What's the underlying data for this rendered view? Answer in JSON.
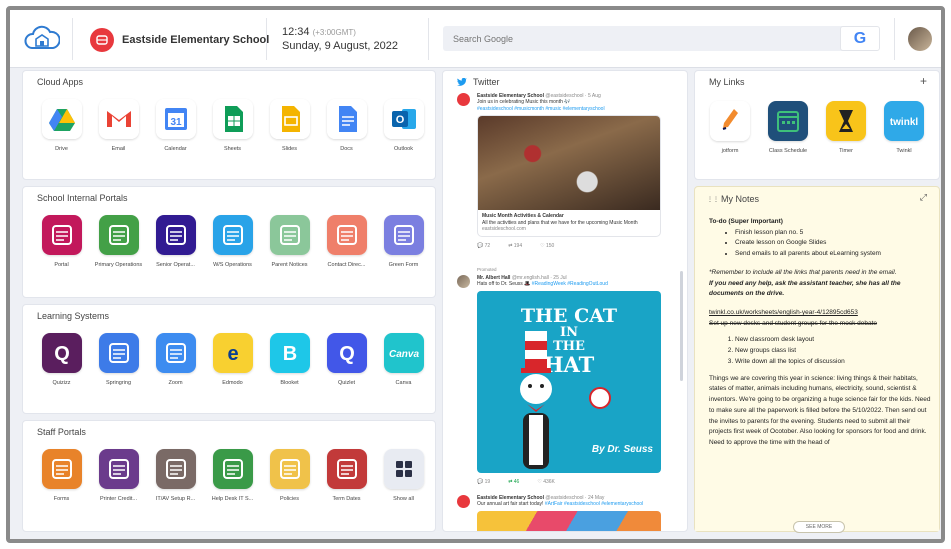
{
  "header": {
    "school_name": "Eastside Elementary School",
    "time": "12:34",
    "timezone": "(+3:00GMT)",
    "date": "Sunday, 9 August, 2022",
    "search_placeholder": "Search Google",
    "google_letter": "G"
  },
  "cloud_apps": {
    "title": "Cloud Apps",
    "items": [
      {
        "label": "Drive",
        "icon": "google-drive-icon"
      },
      {
        "label": "Email",
        "icon": "gmail-icon"
      },
      {
        "label": "Calendar",
        "icon": "calendar-icon",
        "glyph": "31"
      },
      {
        "label": "Sheets",
        "icon": "sheets-icon"
      },
      {
        "label": "Slides",
        "icon": "slides-icon"
      },
      {
        "label": "Docs",
        "icon": "docs-icon"
      },
      {
        "label": "Outlook",
        "icon": "outlook-icon",
        "glyph": "O"
      }
    ]
  },
  "internal_portals": {
    "title": "School Internal Portals",
    "items": [
      {
        "label": "Portal",
        "icon": "graduation-cap-icon",
        "color": "#c2185b"
      },
      {
        "label": "Primary Operations",
        "icon": "lightbulb-icon",
        "color": "#43a047"
      },
      {
        "label": "Senior Operat...",
        "icon": "book-icon",
        "color": "#311b92"
      },
      {
        "label": "W/S Operations",
        "icon": "apple-icon",
        "color": "#29a3e8"
      },
      {
        "label": "Parent Notices",
        "icon": "notice-board-icon",
        "color": "#8bc79a"
      },
      {
        "label": "Contact Direc...",
        "icon": "contact-icon",
        "color": "#ef7f6a"
      },
      {
        "label": "Green Form",
        "icon": "form-icon",
        "color": "#7b7fe0"
      }
    ]
  },
  "learning_systems": {
    "title": "Learning Systems",
    "items": [
      {
        "label": "Quizizz",
        "icon": "quizizz-icon",
        "glyph": "Q",
        "color": "#5a1e5e"
      },
      {
        "label": "Springring",
        "icon": "springring-icon",
        "color": "#3d7be8"
      },
      {
        "label": "Zoom",
        "icon": "video-camera-icon",
        "color": "#3d8cf0"
      },
      {
        "label": "Edmodo",
        "icon": "edmodo-icon",
        "glyph": "e",
        "color": "#f8d030"
      },
      {
        "label": "Blooket",
        "icon": "blooket-icon",
        "glyph": "B",
        "color": "#1ec7e8"
      },
      {
        "label": "Quizlet",
        "icon": "quizlet-icon",
        "glyph": "Q",
        "color": "#4257e8"
      },
      {
        "label": "Canva",
        "icon": "canva-icon",
        "glyph": "Canva",
        "color": "#20c4cc"
      }
    ]
  },
  "staff_portals": {
    "title": "Staff Portals",
    "items": [
      {
        "label": "Forms",
        "icon": "forms-icon",
        "color": "#e8832a"
      },
      {
        "label": "Printer Credit...",
        "icon": "printer-icon",
        "color": "#6b3b8c"
      },
      {
        "label": "IT/AV Setup R...",
        "icon": "projector-icon",
        "color": "#7a6a66"
      },
      {
        "label": "Help Desk IT S...",
        "icon": "headset-icon",
        "color": "#3a9a48"
      },
      {
        "label": "Policies",
        "icon": "policies-icon",
        "color": "#f0c24a"
      },
      {
        "label": "Term Dates",
        "icon": "calendar-check-icon",
        "color": "#c23a3a"
      },
      {
        "label": "Show all",
        "icon": "grid-icon",
        "color": "#e8ebf2"
      }
    ]
  },
  "twitter": {
    "title": "Twitter",
    "tweets": [
      {
        "name": "Eastside Elementary School",
        "handle": "@eastsideschool · 5 Aug",
        "text": "Join us in celebrating Music this month 🎶",
        "tags": "#eastsideschool #musicmonth #music #elementaryschool",
        "card_title": "Music Month Activities & Calendar",
        "card_text": "All the activities and plans that we have for the upcoming Music Month",
        "card_url": "eastsideschool.com",
        "replies": "72",
        "retweets": "194",
        "likes": "150"
      },
      {
        "promoted": "Promoted",
        "name": "Mr. Albert Hall",
        "handle": "@mr.english.hall · 25 Jul",
        "text": "Hats off to Dr. Seuss 🎩",
        "tags": "#ReadingWeek #ReadingOutLoud",
        "image_line1": "THE CAT",
        "image_line2": "IN",
        "image_line3": "THE",
        "image_line4": "HAT",
        "image_author": "By Dr. Seuss",
        "replies": "19",
        "retweets": "46",
        "likes": "436K"
      },
      {
        "name": "Eastside Elementary School",
        "handle": "@eastsideschool · 24 May",
        "text": "Our annual art fair start today!",
        "tags": "#ArtFair #eastsideschool #elementaryschool"
      }
    ]
  },
  "my_links": {
    "title": "My Links",
    "add": "+",
    "items": [
      {
        "label": "jotform",
        "icon": "jotform-icon",
        "color": "#ffffff"
      },
      {
        "label": "Class Schedule",
        "icon": "schedule-icon",
        "color": "#1f4f7a"
      },
      {
        "label": "Timer",
        "icon": "hourglass-icon",
        "color": "#f8c41a"
      },
      {
        "label": "Twinkl",
        "icon": "twinkl-icon",
        "glyph": "twinkl",
        "color": "#2fa9e8"
      }
    ]
  },
  "my_notes": {
    "title": "My Notes",
    "todo_title": "To-do (Super Important)",
    "todo": [
      "Finish lesson plan no. 5",
      "Create lesson on Google Slides",
      "Send emails to all parents about eLearning system"
    ],
    "reminder": "*Remember to include all the links that parents need in the email.",
    "help": "If you need any help, ask the assistant teacher, she has all the documents on the drive.",
    "link": "twinkl.co.uk/worksheets/english-year-4/12895cd653",
    "struck": "Set up new desks and student groups for the mock debate",
    "numbered": [
      "New classroom desk layout",
      "New groups class list",
      "Write down all the topics of discussion"
    ],
    "paragraph": "Things we are covering this year in science: living things & their habitats, states of matter, animals including humans, electricity, sound, scientist & inventors. We're going to be organizing a huge science fair for the kids. Need to make sure all the paperwork is filled before the 5/10/2022. Then send out the invites to parents for the evening. Students need to submit all their projects first week of Ocotober. Also looking for sponsors for food and drink. Need to approve the time with the head of",
    "see_more": "SEE MORE"
  }
}
